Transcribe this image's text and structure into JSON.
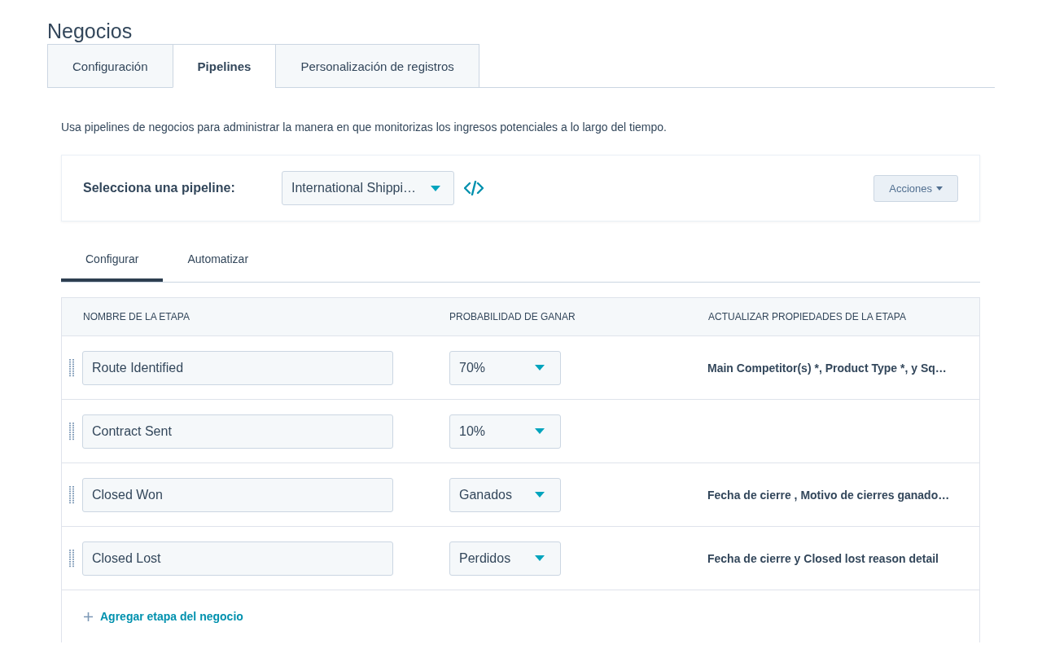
{
  "page_title": "Negocios",
  "tabs": [
    {
      "label": "Configuración",
      "selected": false
    },
    {
      "label": "Pipelines",
      "selected": true
    },
    {
      "label": "Personalización de registros",
      "selected": false
    }
  ],
  "description": "Usa pipelines de negocios para administrar la manera en que monitorizas los ingresos potenciales a lo largo del tiempo.",
  "pipeline_selector": {
    "label": "Selecciona una pipeline:",
    "value": "International Shippi…"
  },
  "actions_button": "Acciones",
  "subtabs": [
    {
      "label": "Configurar",
      "selected": true
    },
    {
      "label": "Automatizar",
      "selected": false
    }
  ],
  "table": {
    "columns": [
      "NOMBRE DE LA ETAPA",
      "PROBABILIDAD DE GANAR",
      "ACTUALIZAR PROPIEDADES DE LA ETAPA"
    ],
    "rows": [
      {
        "name": "Route Identified",
        "probability": "70%",
        "properties": "Main Competitor(s) *, Product Type *, y Sq…"
      },
      {
        "name": "Contract Sent",
        "probability": "10%"
      },
      {
        "name": "Closed Won",
        "probability": "Ganados",
        "properties": "Fecha de cierre , Motivo de cierres ganado…"
      },
      {
        "name": "Closed Lost",
        "probability": "Perdidos",
        "properties": "Fecha de cierre y Closed lost reason detail"
      }
    ]
  },
  "add_stage": "Agregar etapa del negocio"
}
